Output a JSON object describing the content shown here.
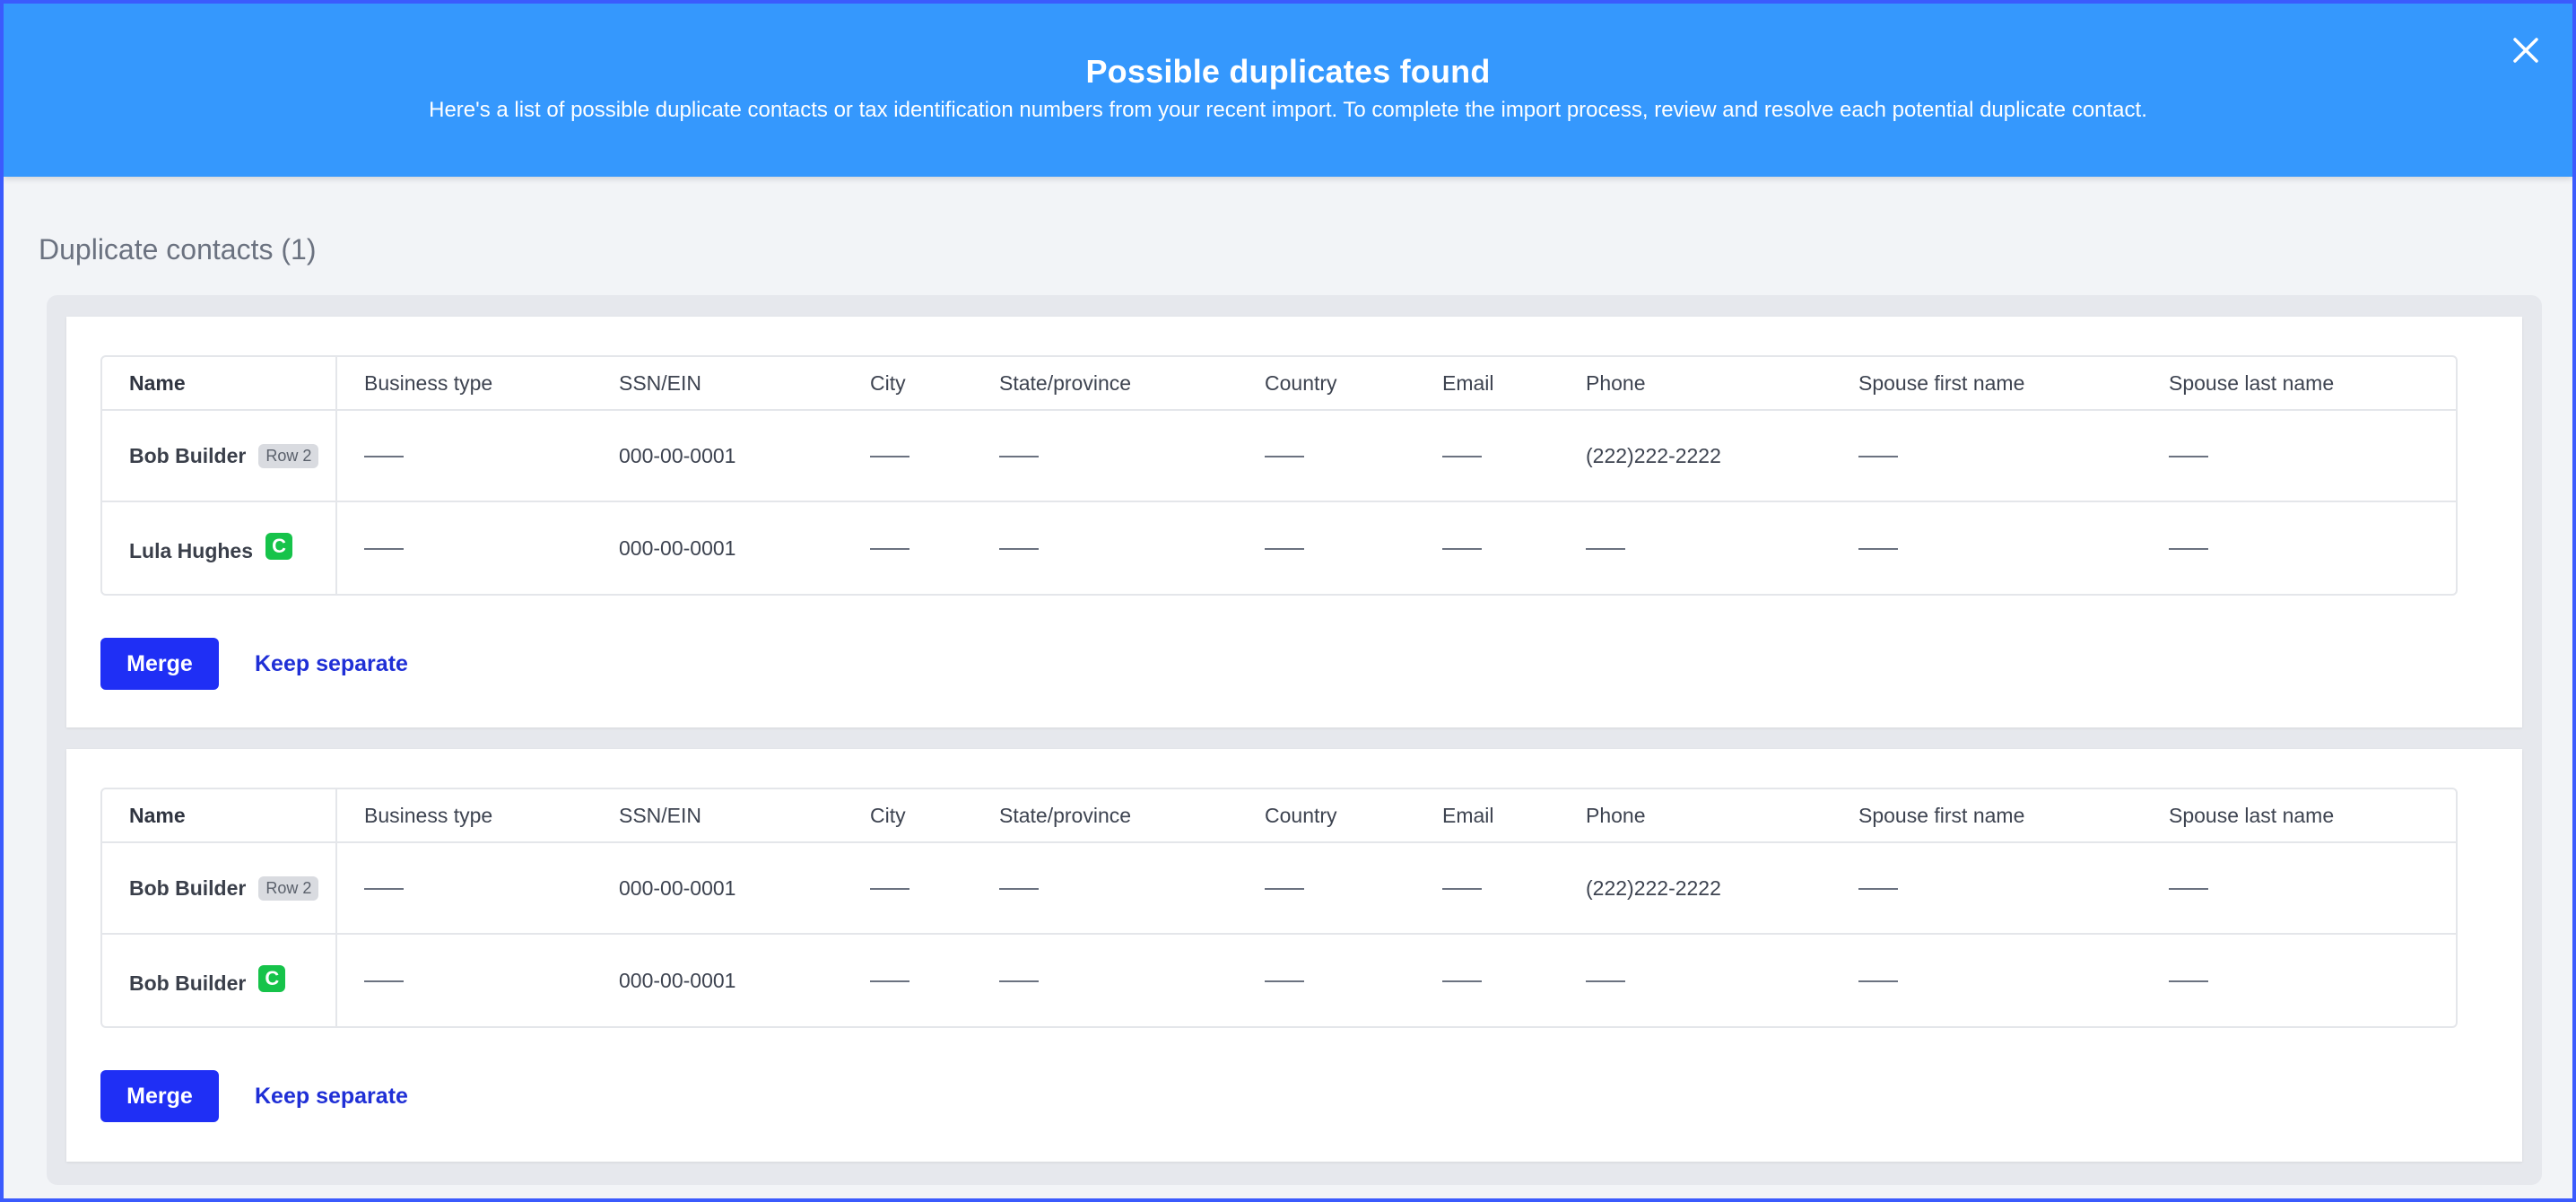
{
  "banner": {
    "title": "Possible duplicates found",
    "subtitle": "Here's a list of possible duplicate contacts or tax identification numbers from your recent import. To complete the import process, review and resolve each potential duplicate contact.",
    "background": "#3598fd",
    "close_icon": "close-icon"
  },
  "section": {
    "title": "Duplicate contacts (1)"
  },
  "columns": [
    "Name",
    "Business type",
    "SSN/EIN",
    "City",
    "State/province",
    "Country",
    "Email",
    "Phone",
    "Spouse first name",
    "Spouse last name"
  ],
  "groups": [
    {
      "rows": [
        {
          "name": "Bob Builder",
          "badge": "Row 2",
          "business_type": "",
          "ssn": "000-00-0001",
          "city": "",
          "state": "",
          "country": "",
          "email": "",
          "phone": "(222)222-2222",
          "spouse_first": "",
          "spouse_last": ""
        },
        {
          "name": "Lula Hughes",
          "badge": "C",
          "business_type": "",
          "ssn": "000-00-0001",
          "city": "",
          "state": "",
          "country": "",
          "email": "",
          "phone": "",
          "spouse_first": "",
          "spouse_last": ""
        }
      ],
      "merge_label": "Merge",
      "keep_label": "Keep separate"
    },
    {
      "rows": [
        {
          "name": "Bob Builder",
          "badge": "Row 2",
          "business_type": "",
          "ssn": "000-00-0001",
          "city": "",
          "state": "",
          "country": "",
          "email": "",
          "phone": "(222)222-2222",
          "spouse_first": "",
          "spouse_last": ""
        },
        {
          "name": "Bob Builder",
          "badge": "C",
          "business_type": "",
          "ssn": "000-00-0001",
          "city": "",
          "state": "",
          "country": "",
          "email": "",
          "phone": "",
          "spouse_first": "",
          "spouse_last": ""
        }
      ],
      "merge_label": "Merge",
      "keep_label": "Keep separate"
    }
  ],
  "colors": {
    "primary_button": "#1f2ff5",
    "link": "#1f2fd6",
    "contact_badge": "#16c34a",
    "row_badge": "#d9dbe0"
  }
}
